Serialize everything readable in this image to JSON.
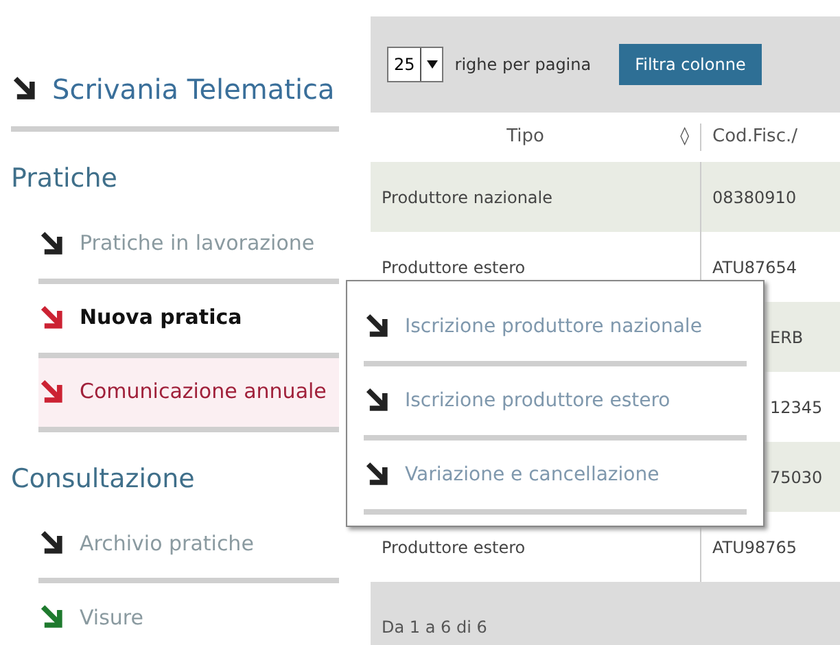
{
  "sidebar": {
    "title": "Scrivania Telematica",
    "sections": [
      {
        "heading": "Pratiche",
        "items": [
          {
            "label": "Pratiche in lavorazione",
            "color": "#222222",
            "selected": false,
            "highlighted": false
          },
          {
            "label": "Nuova pratica",
            "color": "#cc2233",
            "selected": true,
            "highlighted": false
          },
          {
            "label": "Comunicazione annuale",
            "color": "#cc2233",
            "selected": false,
            "highlighted": true
          }
        ]
      },
      {
        "heading": "Consultazione",
        "items": [
          {
            "label": "Archivio pratiche",
            "color": "#222222",
            "selected": false,
            "highlighted": false
          },
          {
            "label": "Visure",
            "color": "#1e7a2e",
            "selected": false,
            "highlighted": false
          }
        ]
      }
    ]
  },
  "toolbar": {
    "page_size": "25",
    "page_size_label": "righe per pagina",
    "filter_button": "Filtra colonne"
  },
  "table": {
    "columns": [
      "Tipo",
      "Cod.Fisc./"
    ],
    "sort_icon": "◊",
    "rows": [
      {
        "kind": "full",
        "cells": [
          "Produttore nazionale",
          "08380910"
        ]
      },
      {
        "kind": "full",
        "cells": [
          "Produttore estero",
          "ATU87654"
        ]
      },
      {
        "kind": "covered",
        "cells": [
          "",
          "ERB"
        ]
      },
      {
        "kind": "covered",
        "cells": [
          "",
          "12345"
        ]
      },
      {
        "kind": "covered",
        "cells": [
          "",
          "75030"
        ]
      },
      {
        "kind": "full",
        "cells": [
          "Produttore estero",
          "ATU98765"
        ]
      }
    ],
    "footer": "Da 1 a 6 di 6"
  },
  "popup_menu": {
    "items": [
      "Iscrizione produttore nazionale",
      "Iscrizione produttore estero",
      "Variazione e cancellazione"
    ]
  }
}
